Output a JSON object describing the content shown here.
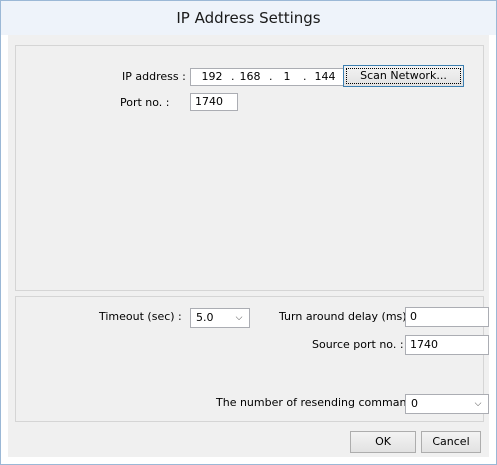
{
  "window": {
    "title": "IP Address Settings"
  },
  "network": {
    "ip_label": "IP address :",
    "ip_octets": [
      "192",
      "168",
      "1",
      "144"
    ],
    "scan_button": "Scan Network...",
    "port_label": "Port no. :",
    "port_value": "1740"
  },
  "comm": {
    "timeout_label": "Timeout (sec) :",
    "timeout_value": "5.0",
    "turnaround_label": "Turn around delay (ms) :",
    "turnaround_value": "0",
    "source_port_label": "Source port no. :",
    "source_port_value": "1740",
    "resend_label": "The number of resending commands :",
    "resend_value": "0"
  },
  "buttons": {
    "ok": "OK",
    "cancel": "Cancel"
  },
  "icons": {
    "dropdown": "chevron-down-icon"
  }
}
